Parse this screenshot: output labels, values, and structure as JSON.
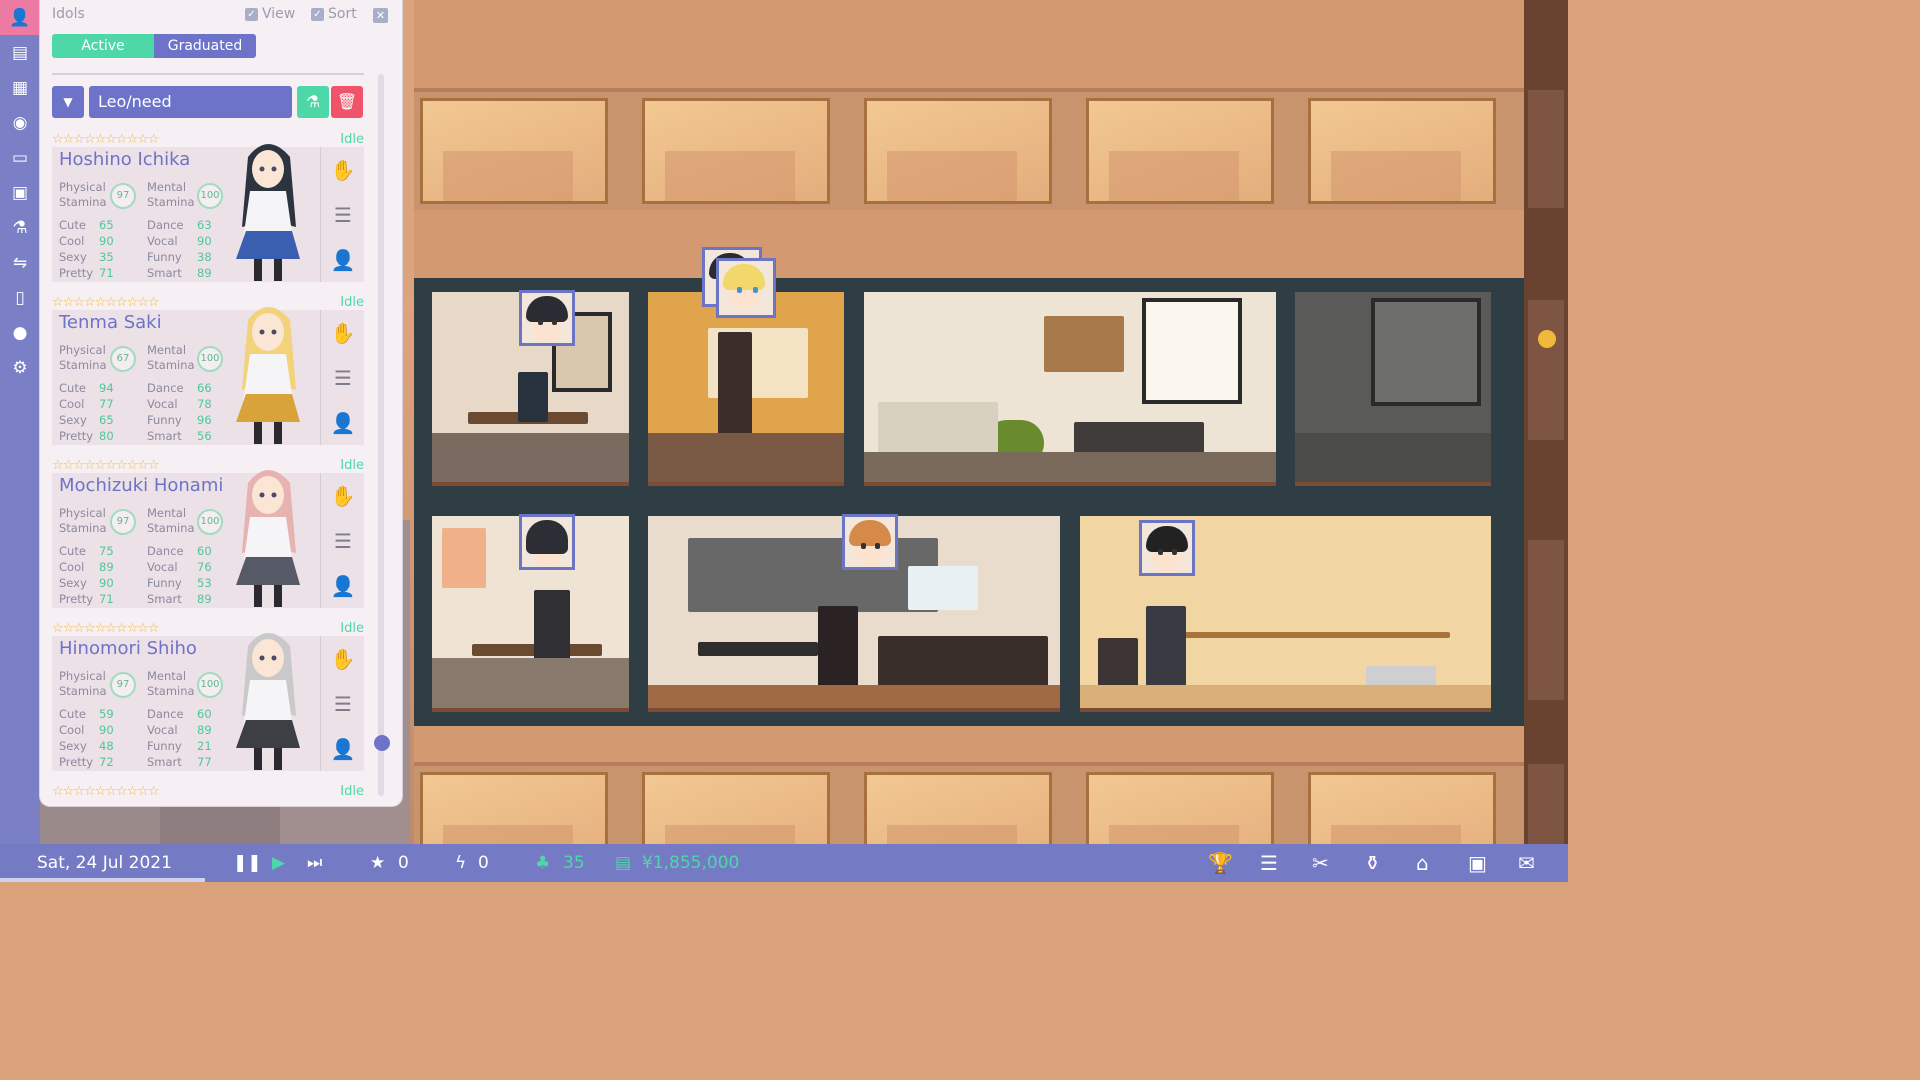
{
  "panel": {
    "title": "Idols",
    "view_label": "View",
    "sort_label": "Sort",
    "close_symbol": "✕",
    "tabs": {
      "active": "Active",
      "graduated": "Graduated"
    },
    "filter_name": "Leo/need",
    "filter_dropdown_symbol": "▼"
  },
  "idols": [
    {
      "name": "Hoshino Ichika",
      "status": "Idle",
      "stars": "☆☆☆☆☆☆☆☆☆☆",
      "physical_stamina": 97,
      "mental_stamina": 100,
      "cute": 65,
      "cool": 90,
      "sexy": 35,
      "pretty": 71,
      "dance": 63,
      "vocal": 90,
      "funny": 38,
      "smart": 89
    },
    {
      "name": "Tenma Saki",
      "status": "Idle",
      "stars": "☆☆☆☆☆☆☆☆☆☆",
      "physical_stamina": 67,
      "mental_stamina": 100,
      "cute": 94,
      "cool": 77,
      "sexy": 65,
      "pretty": 80,
      "dance": 66,
      "vocal": 78,
      "funny": 96,
      "smart": 56
    },
    {
      "name": "Mochizuki Honami",
      "status": "Idle",
      "stars": "☆☆☆☆☆☆☆☆☆☆",
      "physical_stamina": 97,
      "mental_stamina": 100,
      "cute": 75,
      "cool": 89,
      "sexy": 90,
      "pretty": 71,
      "dance": 60,
      "vocal": 76,
      "funny": 53,
      "smart": 89
    },
    {
      "name": "Hinomori Shiho",
      "status": "Idle",
      "stars": "☆☆☆☆☆☆☆☆☆☆",
      "physical_stamina": 97,
      "mental_stamina": 100,
      "cute": 59,
      "cool": 90,
      "sexy": 48,
      "pretty": 72,
      "dance": 60,
      "vocal": 89,
      "funny": 21,
      "smart": 77
    }
  ],
  "partial_card": {
    "stars": "☆☆☆☆☆☆☆☆☆☆",
    "status": "Idle"
  },
  "labels": {
    "physical": "Physical",
    "mental": "Mental",
    "stamina": "Stamina",
    "cute": "Cute",
    "cool": "Cool",
    "sexy": "Sexy",
    "pretty": "Pretty",
    "dance": "Dance",
    "vocal": "Vocal",
    "funny": "Funny",
    "smart": "Smart"
  },
  "bottombar": {
    "date": "Sat, 24 Jul 2021",
    "stars": "0",
    "energy": "0",
    "fans": "35",
    "money": "¥1,855,000"
  },
  "colors": {
    "accent": "#6d73c9",
    "green": "#4ed7a7",
    "pink": "#ec7aa2",
    "red": "#f0536a",
    "gold": "#f0b93a"
  },
  "rail_icons": [
    "idol-icon",
    "id-card-icon",
    "calendar-icon",
    "disc-icon",
    "tv-icon",
    "event-calendar-icon",
    "flask-icon",
    "toggle-icon",
    "phone-icon",
    "lightbulb-icon",
    "gear-icon"
  ],
  "bottom_icons": [
    "pause-icon",
    "play-icon",
    "fast-forward-icon",
    "star-icon",
    "bolt-icon",
    "fans-icon",
    "money-icon",
    "trophy-icon",
    "list-icon",
    "scissors-icon",
    "money-bag-icon",
    "bank-icon",
    "briefcase-icon",
    "mail-icon"
  ]
}
